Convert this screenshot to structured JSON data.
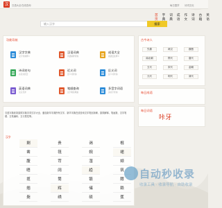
{
  "topbar": {
    "logo_char": "汉",
    "links": [
      "汉语大全",
      "在线查询"
    ],
    "right_links": [
      "每日国学",
      "诗词文化"
    ]
  },
  "nav": {
    "items": [
      "首页",
      "字典",
      "词典",
      "成语",
      "作文",
      "诗词",
      "古籍",
      "英语"
    ],
    "active": "首页"
  },
  "search": {
    "placeholder": "输入汉字",
    "button": "搜索"
  },
  "tools": {
    "title": "功能导航",
    "items": [
      {
        "name": "汉字字典",
        "desc": "汉字查询释义",
        "color": "#2c8cd8"
      },
      {
        "name": "汉语词典",
        "desc": "词语解释查询",
        "color": "#e0582c"
      },
      {
        "name": "成语大全",
        "desc": "成语出处释义",
        "color": "#e7a520"
      },
      {
        "name": "诗词名句",
        "desc": "古诗文欣赏",
        "color": "#3aaa5c"
      },
      {
        "name": "近义词",
        "desc": "近义词查询",
        "color": "#e0582c"
      },
      {
        "name": "反义词",
        "desc": "反义词查询",
        "color": "#2c8cd8"
      },
      {
        "name": "英语词典",
        "desc": "英汉互译",
        "color": "#7a5bd0"
      },
      {
        "name": "笔顺查询",
        "desc": "汉字笔画笔顺",
        "color": "#e0582c"
      },
      {
        "name": "多音字词语",
        "desc": "多音字查询",
        "color": "#2c8cd8"
      }
    ]
  },
  "dynasty": {
    "title": "古今诗人",
    "items": [
      "先秦",
      "两汉",
      "魏晋",
      "南北朝",
      "隋代",
      "唐代",
      "五代",
      "宋代",
      "金朝",
      "元代",
      "明代",
      "清代"
    ]
  },
  "intro": "汉语字典收录康熙字典字词汉字大全，囊括新华字典所有汉字，新华字典在线查询汉字笔划拆解，康熙解释，笔画数、汉字笔顺、五笔编码、五行属性等。",
  "grid": {
    "label": "汉字",
    "chars": [
      "剩",
      "贵",
      "谒",
      "棍",
      "凿",
      "筏",
      "婉",
      "裙",
      "腹",
      "苛",
      "湿",
      "颊",
      "晤",
      "阔",
      "趋",
      "筑",
      "揽",
      "筒",
      "锻",
      "酵",
      "翘",
      "辉",
      "储",
      "赖",
      "毙",
      "绣",
      "硕",
      "蕉"
    ]
  },
  "random_word": {
    "title": "每日词语",
    "word": "咔牙"
  },
  "random2": {
    "title": "每日成语"
  },
  "watermark": {
    "line1": "自动秒收录",
    "line2": "收录工具 · 收录导航 · 自助收录"
  }
}
